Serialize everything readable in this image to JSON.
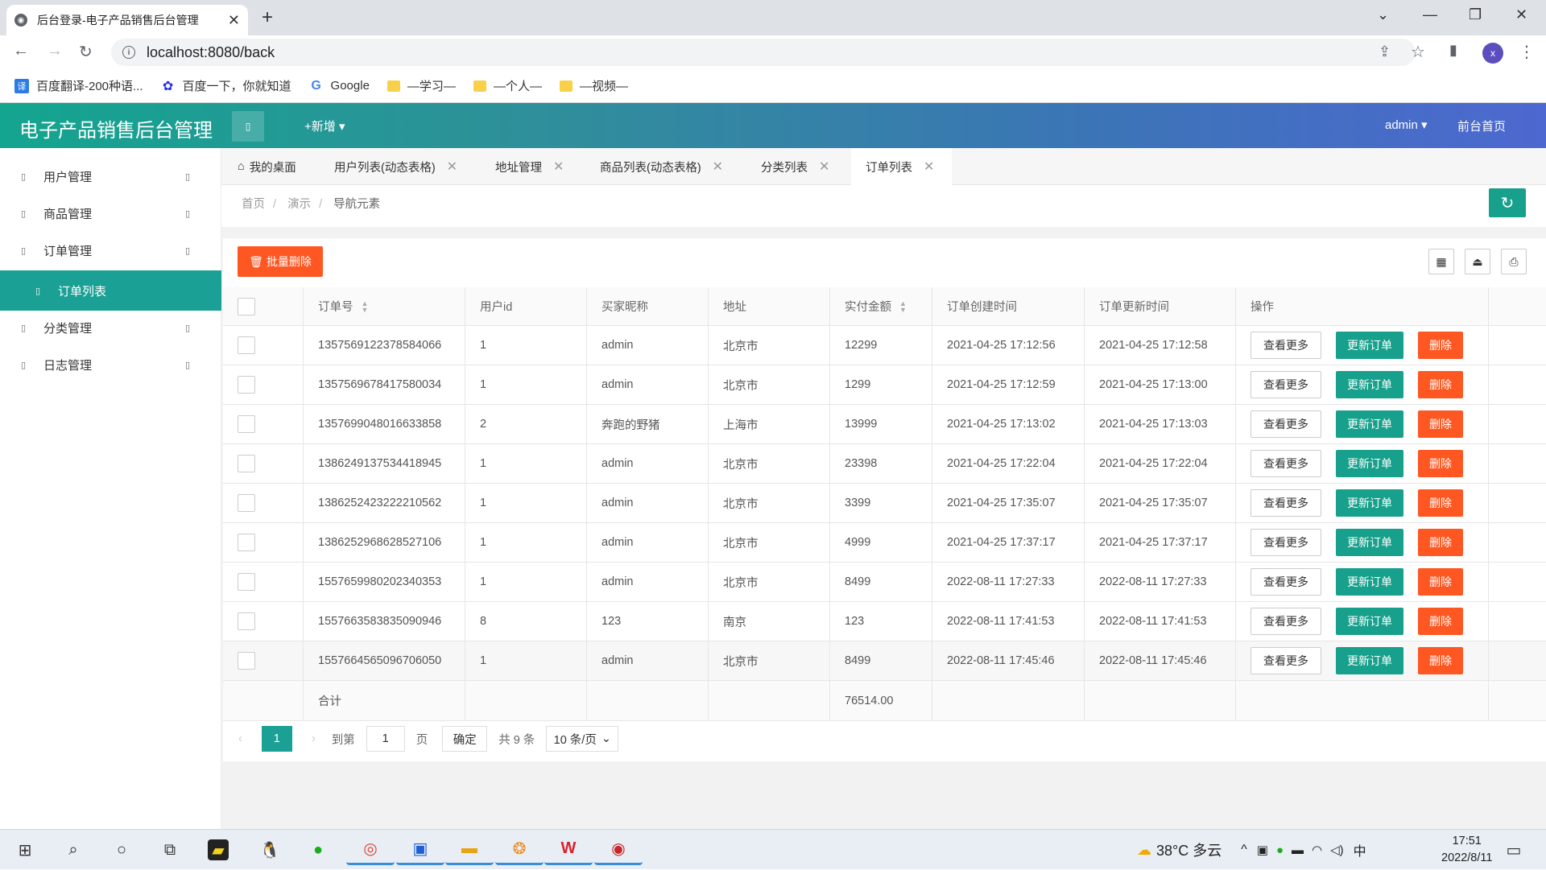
{
  "browser": {
    "tab_title": "后台登录-电子产品销售后台管理",
    "url": "localhost:8080/back",
    "profile_initial": "x",
    "bookmarks": [
      {
        "label": "百度翻译-200种语...",
        "icon": "translate-icon"
      },
      {
        "label": "百度一下，你就知道",
        "icon": "baidu-paw-icon"
      },
      {
        "label": "Google",
        "icon": "google-icon"
      },
      {
        "label": "—学习—",
        "icon": "folder-icon"
      },
      {
        "label": "—个人—",
        "icon": "folder-icon"
      },
      {
        "label": "—视频—",
        "icon": "folder-icon"
      }
    ]
  },
  "app": {
    "brand": "电子产品销售后台管理",
    "new_label": "+新增",
    "admin_label": "admin",
    "front_home": "前台首页",
    "accent": "#1aa094",
    "danger": "#ff5722"
  },
  "sidebar": {
    "items": [
      {
        "label": "用户管理"
      },
      {
        "label": "商品管理"
      },
      {
        "label": "订单管理"
      },
      {
        "label": "订单列表"
      },
      {
        "label": "分类管理"
      },
      {
        "label": "日志管理"
      }
    ]
  },
  "page_tabs": [
    {
      "label": "我的桌面"
    },
    {
      "label": "用户列表(动态表格)"
    },
    {
      "label": "地址管理"
    },
    {
      "label": "商品列表(动态表格)"
    },
    {
      "label": "分类列表"
    },
    {
      "label": "订单列表"
    }
  ],
  "breadcrumb": [
    "首页",
    "演示",
    "导航元素"
  ],
  "toolbar": {
    "batch_delete": "批量删除"
  },
  "table": {
    "headers": [
      "订单号",
      "用户id",
      "买家昵称",
      "地址",
      "实付金额",
      "订单创建时间",
      "订单更新时间",
      "操作"
    ],
    "rows": [
      [
        "1357569122378584066",
        "1",
        "admin",
        "北京市",
        "12299",
        "2021-04-25 17:12:56",
        "2021-04-25 17:12:58"
      ],
      [
        "1357569678417580034",
        "1",
        "admin",
        "北京市",
        "1299",
        "2021-04-25 17:12:59",
        "2021-04-25 17:13:00"
      ],
      [
        "1357699048016633858",
        "2",
        "奔跑的野猪",
        "上海市",
        "13999",
        "2021-04-25 17:13:02",
        "2021-04-25 17:13:03"
      ],
      [
        "1386249137534418945",
        "1",
        "admin",
        "北京市",
        "23398",
        "2021-04-25 17:22:04",
        "2021-04-25 17:22:04"
      ],
      [
        "1386252423222210562",
        "1",
        "admin",
        "北京市",
        "3399",
        "2021-04-25 17:35:07",
        "2021-04-25 17:35:07"
      ],
      [
        "1386252968628527106",
        "1",
        "admin",
        "北京市",
        "4999",
        "2021-04-25 17:37:17",
        "2021-04-25 17:37:17"
      ],
      [
        "1557659980202340353",
        "1",
        "admin",
        "北京市",
        "8499",
        "2022-08-11 17:27:33",
        "2022-08-11 17:27:33"
      ],
      [
        "1557663583835090946",
        "8",
        "123",
        "南京",
        "123",
        "2022-08-11 17:41:53",
        "2022-08-11 17:41:53"
      ],
      [
        "1557664565096706050",
        "1",
        "admin",
        "北京市",
        "8499",
        "2022-08-11 17:45:46",
        "2022-08-11 17:45:46"
      ]
    ],
    "actions": {
      "more": "查看更多",
      "update": "更新订单",
      "delete": "删除"
    },
    "footer_label": "合计",
    "footer_total": "76514.00"
  },
  "pager": {
    "current": "1",
    "goto_label": "到第",
    "goto_value": "1",
    "page_unit": "页",
    "confirm": "确定",
    "total": "共 9 条",
    "page_size": "10 条/页"
  },
  "taskbar": {
    "weather": "38°C 多云",
    "ime": "中",
    "time": "17:51",
    "date": "2022/8/11"
  }
}
